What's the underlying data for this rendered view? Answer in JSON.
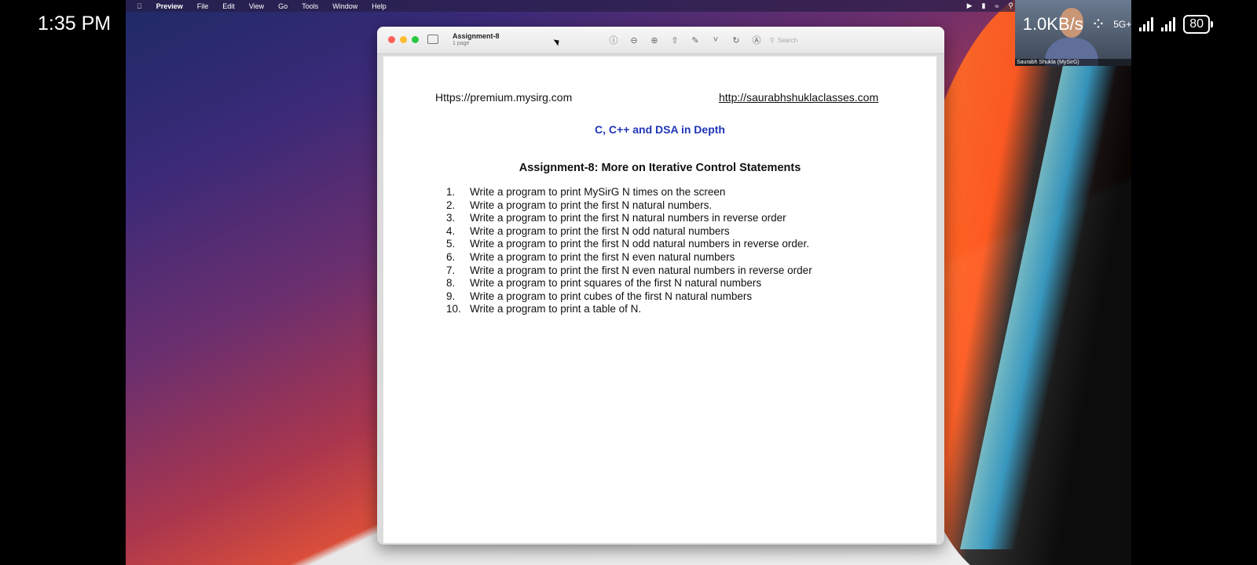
{
  "phone_status": {
    "time": "1:35 PM",
    "net_speed": "1.0KB/s",
    "network": "5G+",
    "battery": "80"
  },
  "mac_menubar": {
    "app": "Preview",
    "items": [
      "File",
      "Edit",
      "View",
      "Go",
      "Tools",
      "Window",
      "Help"
    ]
  },
  "window": {
    "title": "Assignment-8",
    "subtitle": "1 page",
    "search_placeholder": "Search"
  },
  "document": {
    "url_left": "Https://premium.mysirg.com",
    "url_right": "http://saurabhshuklaclasses.com",
    "course_title": "C, C++ and DSA in Depth",
    "assignment_title": "Assignment-8: More on Iterative Control Statements",
    "questions": [
      {
        "num": "1.",
        "text": "Write a program to print MySirG N times on the screen"
      },
      {
        "num": "2.",
        "text": "Write a program to print the first N natural numbers."
      },
      {
        "num": "3.",
        "text": "Write a program to print the first N natural numbers in reverse order"
      },
      {
        "num": "4.",
        "text": "Write a program to print the first N odd natural numbers"
      },
      {
        "num": "5.",
        "text": "Write a program to print the first N odd natural numbers in reverse order."
      },
      {
        "num": "6.",
        "text": "Write a program to print the first N even natural numbers"
      },
      {
        "num": "7.",
        "text": "Write a program to print the first N even natural numbers in reverse order"
      },
      {
        "num": "8.",
        "text": "Write a program to print squares of the first N natural numbers"
      },
      {
        "num": "9.",
        "text": "Write a program to print cubes of the first N natural numbers"
      },
      {
        "num": "10.",
        "text": "Write a program to print a table of N."
      }
    ]
  },
  "video_overlay": {
    "caption": "Saurabh Shukla (MySirG)"
  },
  "colors": {
    "traffic_close": "#fe5f57",
    "traffic_min": "#febc2e",
    "traffic_max": "#28c840",
    "course_title": "#1f35b8"
  }
}
